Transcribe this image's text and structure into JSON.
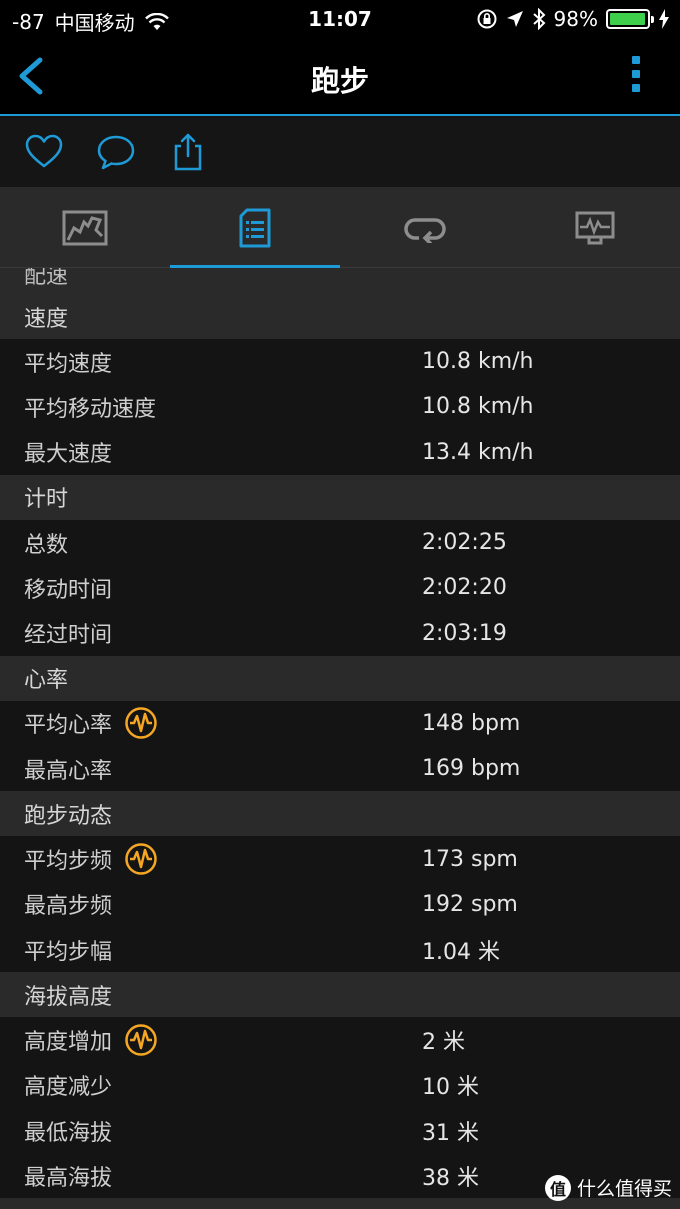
{
  "status_bar": {
    "signal": "-87",
    "carrier": "中国移动",
    "time": "11:07",
    "battery": "98%",
    "battery_level": 0.98
  },
  "nav": {
    "title": "跑步"
  },
  "accent_color": "#1e9bd7",
  "hr_icon_color": "#f5a623",
  "partial_section": "配速",
  "sections": [
    {
      "title": "速度",
      "rows": [
        {
          "label": "平均速度",
          "value": "10.8 km/h",
          "icon": false
        },
        {
          "label": "平均移动速度",
          "value": "10.8 km/h",
          "icon": false
        },
        {
          "label": "最大速度",
          "value": "13.4 km/h",
          "icon": false
        }
      ]
    },
    {
      "title": "计时",
      "rows": [
        {
          "label": "总数",
          "value": "2:02:25",
          "icon": false
        },
        {
          "label": "移动时间",
          "value": "2:02:20",
          "icon": false
        },
        {
          "label": "经过时间",
          "value": "2:03:19",
          "icon": false
        }
      ]
    },
    {
      "title": "心率",
      "rows": [
        {
          "label": "平均心率",
          "value": "148 bpm",
          "icon": true
        },
        {
          "label": "最高心率",
          "value": "169 bpm",
          "icon": false
        }
      ]
    },
    {
      "title": "跑步动态",
      "rows": [
        {
          "label": "平均步频",
          "value": "173 spm",
          "icon": true
        },
        {
          "label": "最高步频",
          "value": "192 spm",
          "icon": false
        },
        {
          "label": "平均步幅",
          "value": "1.04 米",
          "icon": false
        }
      ]
    },
    {
      "title": "海拔高度",
      "rows": [
        {
          "label": "高度增加",
          "value": "2 米",
          "icon": true
        },
        {
          "label": "高度减少",
          "value": "10 米",
          "icon": false
        },
        {
          "label": "最低海拔",
          "value": "31 米",
          "icon": false
        },
        {
          "label": "最高海拔",
          "value": "38 米",
          "icon": false
        }
      ]
    }
  ],
  "watermark": {
    "badge": "值",
    "text": "什么值得买"
  }
}
